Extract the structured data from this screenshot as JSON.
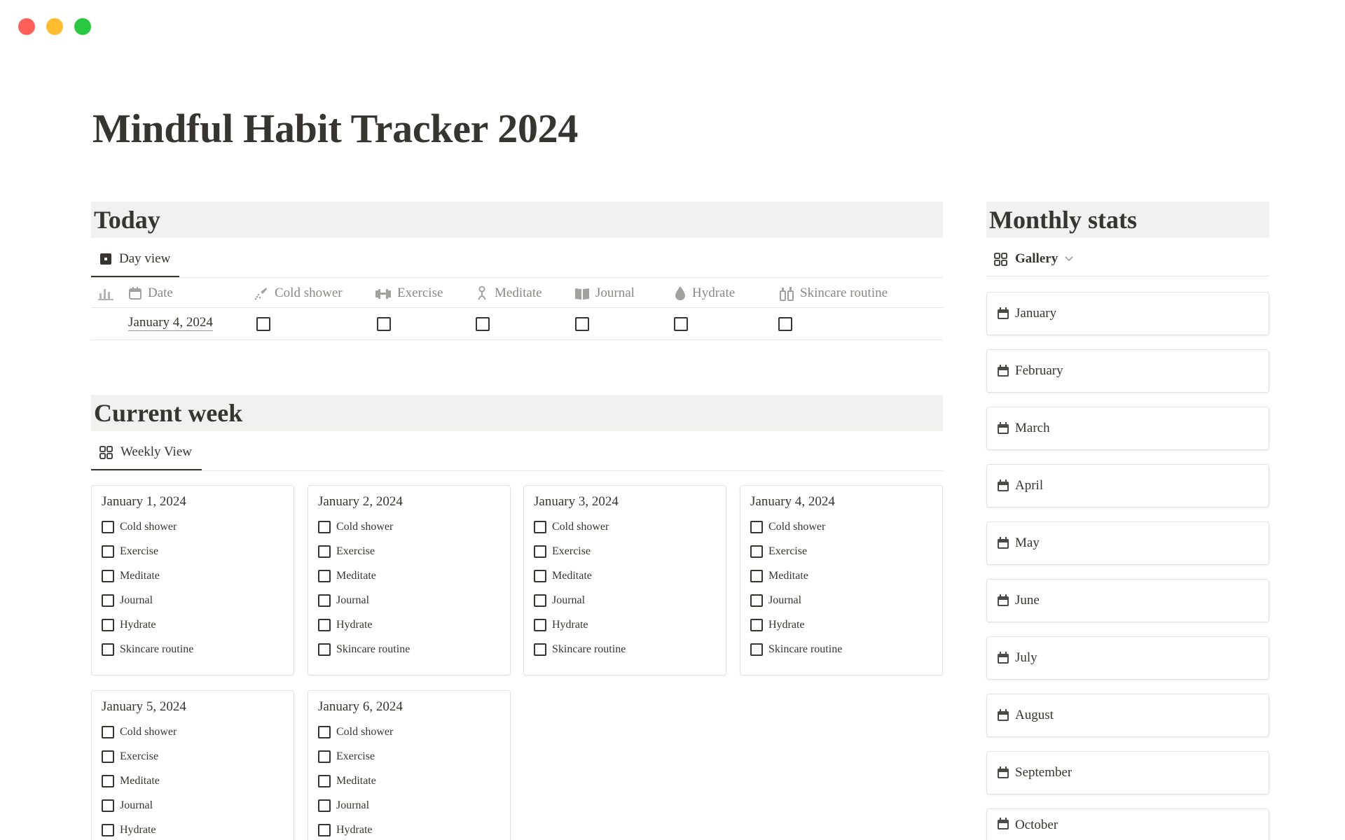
{
  "window": {
    "controls": [
      "close",
      "minimize",
      "zoom"
    ]
  },
  "page": {
    "title": "Mindful Habit Tracker 2024"
  },
  "today": {
    "heading": "Today",
    "view_label": "Day view",
    "columns": [
      {
        "key": "date",
        "label": "Date",
        "icon": "calendar-icon"
      },
      {
        "key": "cold_shower",
        "label": "Cold shower",
        "icon": "shower-icon"
      },
      {
        "key": "exercise",
        "label": "Exercise",
        "icon": "dumbbell-icon"
      },
      {
        "key": "meditate",
        "label": "Meditate",
        "icon": "meditate-icon"
      },
      {
        "key": "journal",
        "label": "Journal",
        "icon": "book-icon"
      },
      {
        "key": "hydrate",
        "label": "Hydrate",
        "icon": "droplet-icon"
      },
      {
        "key": "skincare",
        "label": "Skincare routine",
        "icon": "bottles-icon"
      }
    ],
    "row": {
      "date": "January 4, 2024",
      "checks": [
        false,
        false,
        false,
        false,
        false,
        false
      ]
    }
  },
  "current_week": {
    "heading": "Current week",
    "view_label": "Weekly View",
    "habits": [
      "Cold shower",
      "Exercise",
      "Meditate",
      "Journal",
      "Hydrate",
      "Skincare routine"
    ],
    "days": [
      {
        "date": "January 1, 2024"
      },
      {
        "date": "January 2, 2024"
      },
      {
        "date": "January 3, 2024"
      },
      {
        "date": "January 4, 2024"
      },
      {
        "date": "January 5, 2024"
      },
      {
        "date": "January 6, 2024"
      }
    ]
  },
  "monthly_stats": {
    "heading": "Monthly stats",
    "view_label": "Gallery",
    "months": [
      "January",
      "February",
      "March",
      "April",
      "May",
      "June",
      "July",
      "August",
      "September",
      "October"
    ]
  },
  "colors": {
    "text": "#37352f",
    "muted": "#8b8985",
    "section_bg": "#f1f1ef",
    "border": "#e3e2df"
  }
}
